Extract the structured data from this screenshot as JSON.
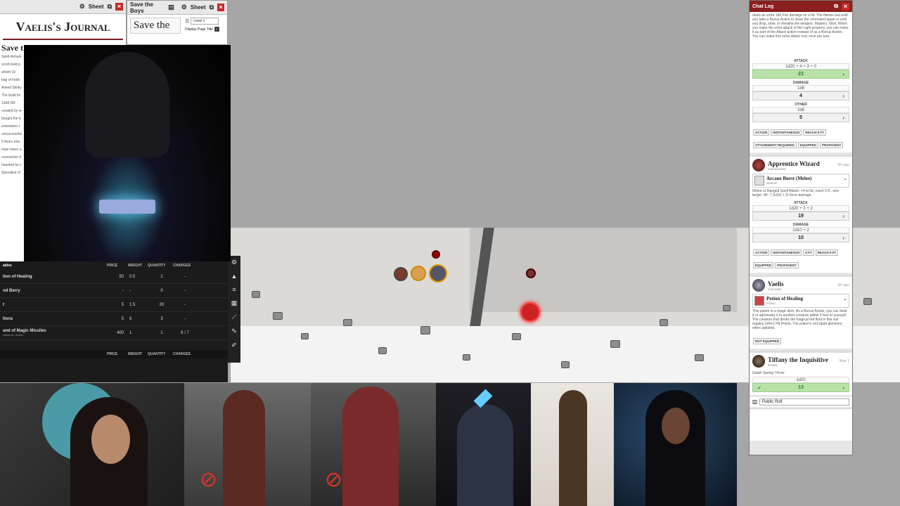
{
  "journal_window": {
    "sheet_label": "Sheet",
    "title": "Vaelis's Journal",
    "side_title": "Save t",
    "notes": [
      "Spell-Refueli",
      "scroll bold p",
      "shield 10",
      "bag of holdi",
      "Asked Stinky",
      "The build kn",
      "1368 DR",
      "created by w",
      "bought the b",
      "entertwine t",
      "unsuccessful",
      "5 floors tota",
      "main tower a",
      "connection b",
      "haunted by c",
      "Specialist of"
    ]
  },
  "boys_window": {
    "title": "Save the Boys",
    "sheet_label": "Sheet",
    "heading": "Save the",
    "level_select": "Level 1",
    "display_title_label": "Display Page Title"
  },
  "inventory": {
    "section_label": "ables",
    "columns": [
      "PRICE",
      "WEIGHT",
      "QUANTITY",
      "CHARGES"
    ],
    "items": [
      {
        "name": "tion of Healing",
        "price": "50",
        "weight": "0.5",
        "qty": "1",
        "charges": "-"
      },
      {
        "name": "od Berry",
        "price": "-",
        "weight": "-",
        "qty": "0",
        "charges": "-"
      },
      {
        "name": "t",
        "price": "5",
        "weight": "1.5",
        "qty": "20",
        "charges": "-"
      },
      {
        "name": "tions",
        "price": "5",
        "weight": "6",
        "qty": "3",
        "charges": "-"
      },
      {
        "name": "and of Magic Missiles",
        "sub": "Attunem • Action",
        "price": "400",
        "weight": "1",
        "qty": "1",
        "charges": "6 / 7"
      }
    ],
    "columns2": [
      "PRICE",
      "WEIGHT",
      "QUANTITY",
      "CHARGES"
    ]
  },
  "chat_log": {
    "title": "Chat Log",
    "top_desc": "deals an extra  1d6 Fire damage on a hit. The flames last until you take a  Bonus Action to issue the command again or until you drop, stow, or sheathe the weapon. Mastery: Nick: When you make the extra attack of the Light property, you can make it as part of the  Attack action instead of as a  Bonus Action. You can make this extra attack only once per turn.",
    "attack_label": "ATTACK",
    "attack_formula": "1d20 + 4 + 3 + 0",
    "attack_total": "23",
    "damage_label": "DAMAGE",
    "damage_formula": "1d6",
    "damage_total": "4",
    "other_label": "OTHER",
    "other_formula": "2d6",
    "other_total": "5",
    "tags1": [
      "ACTION",
      "INSTANTANEOUS",
      "REACH 5 FT",
      "ATTUNEMENT REQUIRED",
      "EQUIPPED",
      "PROFICIENT"
    ],
    "card2": {
      "name": "Apprentice Wizard",
      "sub": "Gamemaster",
      "time": "5m ago",
      "spell": "Arcane Burst (Melee)",
      "spell_sub": "Natural",
      "desc": "Melee or Ranged Spell Attack: +4 to hit, reach 5 ft., one target. Hit: 7 (1d10 + 2) force damage.",
      "attack_label": "ATTACK",
      "attack_formula": "1d20 + 2 + 2",
      "attack_total": "19",
      "damage_label": "DAMAGE",
      "damage_formula": "1d10 + 2",
      "damage_total": "10",
      "tags": [
        "ACTION",
        "INSTANTANEOUS",
        "5 FT",
        "REACH 5 FT",
        "EQUIPPED",
        "PROFICIENT"
      ]
    },
    "card3": {
      "name": "Vaelis",
      "sub": "Journalist",
      "time": "5m ago",
      "item": "Potion of Healing",
      "item_sub": "Potion",
      "desc": "This potion is a magic item. As a  Bonus Action, you can drink it or administer it to another creature within 5 feet of yourself. The creature that drinks the magical red fluid in this vial regains  2d4+2  Hit Points. The potion's red liquid glimmers when agitated.",
      "tags": [
        "NOT EQUIPPED"
      ]
    },
    "card4": {
      "name": "Tiffany the Inquisitive",
      "sub": "Bubble",
      "time": "Now 1",
      "roll_label": "Death Saving Throw",
      "formula": "1d20",
      "total": "13"
    },
    "roll_mode": "Public Roll"
  },
  "colors": {
    "chat_header": "#8b1e1e",
    "green_roll": "#b8e2a8",
    "close": "#c62828",
    "map_bg": "#d8d6d2"
  }
}
